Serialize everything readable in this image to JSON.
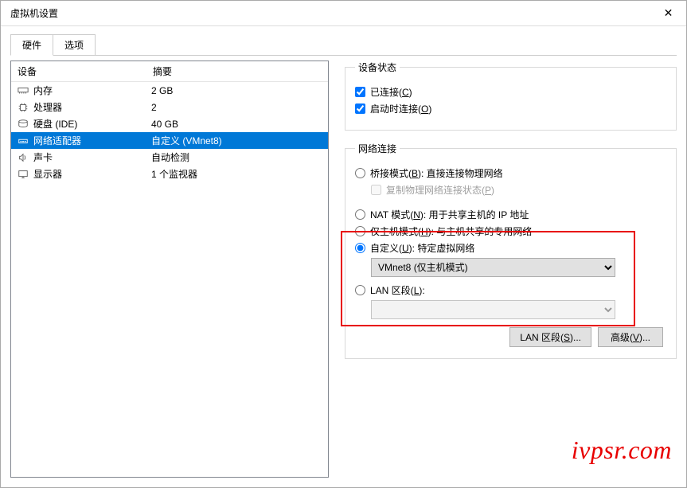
{
  "window": {
    "title": "虚拟机设置"
  },
  "tabs": {
    "hardware": "硬件",
    "options": "选项"
  },
  "device_table": {
    "header_device": "设备",
    "header_summary": "摘要",
    "rows": [
      {
        "icon": "memory",
        "name": "内存",
        "summary": "2 GB"
      },
      {
        "icon": "cpu",
        "name": "处理器",
        "summary": "2"
      },
      {
        "icon": "disk",
        "name": "硬盘 (IDE)",
        "summary": "40 GB"
      },
      {
        "icon": "network",
        "name": "网络适配器",
        "summary": "自定义 (VMnet8)"
      },
      {
        "icon": "sound",
        "name": "声卡",
        "summary": "自动检测"
      },
      {
        "icon": "display",
        "name": "显示器",
        "summary": "1 个监视器"
      }
    ]
  },
  "device_status": {
    "legend": "设备状态",
    "connected": "已连接(C)",
    "connect_at_poweron": "启动时连接(O)"
  },
  "network": {
    "legend": "网络连接",
    "bridged": "桥接模式(B): 直接连接物理网络",
    "replicate": "复制物理网络连接状态(P)",
    "nat": "NAT 模式(N): 用于共享主机的 IP 地址",
    "hostonly": "仅主机模式(H): 与主机共享的专用网络",
    "custom": "自定义(U): 特定虚拟网络",
    "custom_value": "VMnet8 (仅主机模式)",
    "lan_segment_radio": "LAN 区段(L):",
    "lan_segments_btn": "LAN 区段(S)...",
    "advanced_btn": "高级(V)..."
  },
  "watermark": "ivpsr.com"
}
